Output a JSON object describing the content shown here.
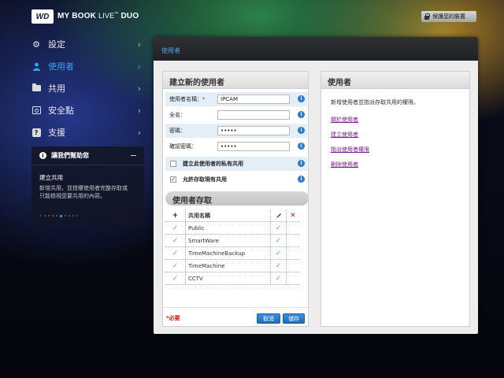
{
  "header": {
    "logo_text": "WD",
    "product_name": "MY BOOK",
    "product_live": "LIVE",
    "product_suffix": "DUO",
    "protect_button": "保護您的裝置"
  },
  "nav": {
    "items": [
      {
        "label": "設定",
        "icon": "gear-icon"
      },
      {
        "label": "使用者",
        "icon": "user-icon",
        "active": true
      },
      {
        "label": "共用",
        "icon": "folder-icon"
      },
      {
        "label": "安全點",
        "icon": "safepoint-icon"
      },
      {
        "label": "支援",
        "icon": "help-icon"
      }
    ]
  },
  "help_panel": {
    "heading": "讓我們幫助您",
    "title": "建立共用",
    "body_line1": "新增共用，並授權使用者完整存取或",
    "body_line2": "只能檢視您要共用的內容。"
  },
  "main": {
    "breadcrumb": "使用者",
    "create_user": {
      "title": "建立新的使用者",
      "fields": {
        "username_label": "使用者名稱：",
        "username_required": "*",
        "username_value": "IPCAM",
        "fullname_label": "全名：",
        "fullname_value": "",
        "password_label": "密碼：",
        "password_value": "•••••",
        "confirm_label": "確認密碼：",
        "confirm_value": "•••••"
      },
      "private_share_label": "建立此使用者的私有共用",
      "private_share_checked": false,
      "allow_existing_label": "允許存取現有共用",
      "allow_existing_checked": true,
      "access_title": "使用者存取",
      "table": {
        "add_symbol": "+",
        "column_share_name": "共用名稱",
        "shares": [
          "Public",
          "SmartWare",
          "TimeMachineBackup",
          "TimeMachine",
          "CCTV"
        ],
        "full_access": [
          true,
          true,
          true,
          true,
          false
        ],
        "read_only": [
          false,
          false,
          false,
          false,
          false
        ]
      },
      "required_note": "*必要",
      "cancel_button": "取消",
      "save_button": "儲存"
    },
    "users_panel": {
      "title": "使用者",
      "description": "新增使用者並指派存取共用的權限。",
      "links": [
        "關於使用者",
        "建立使用者",
        "指派使用者權限",
        "刪除使用者"
      ]
    }
  },
  "colors": {
    "accent_blue": "#35a7ee",
    "link_purple": "#7a1a8e",
    "required_red": "#d0221a",
    "button_blue": "#2a7cc6"
  }
}
